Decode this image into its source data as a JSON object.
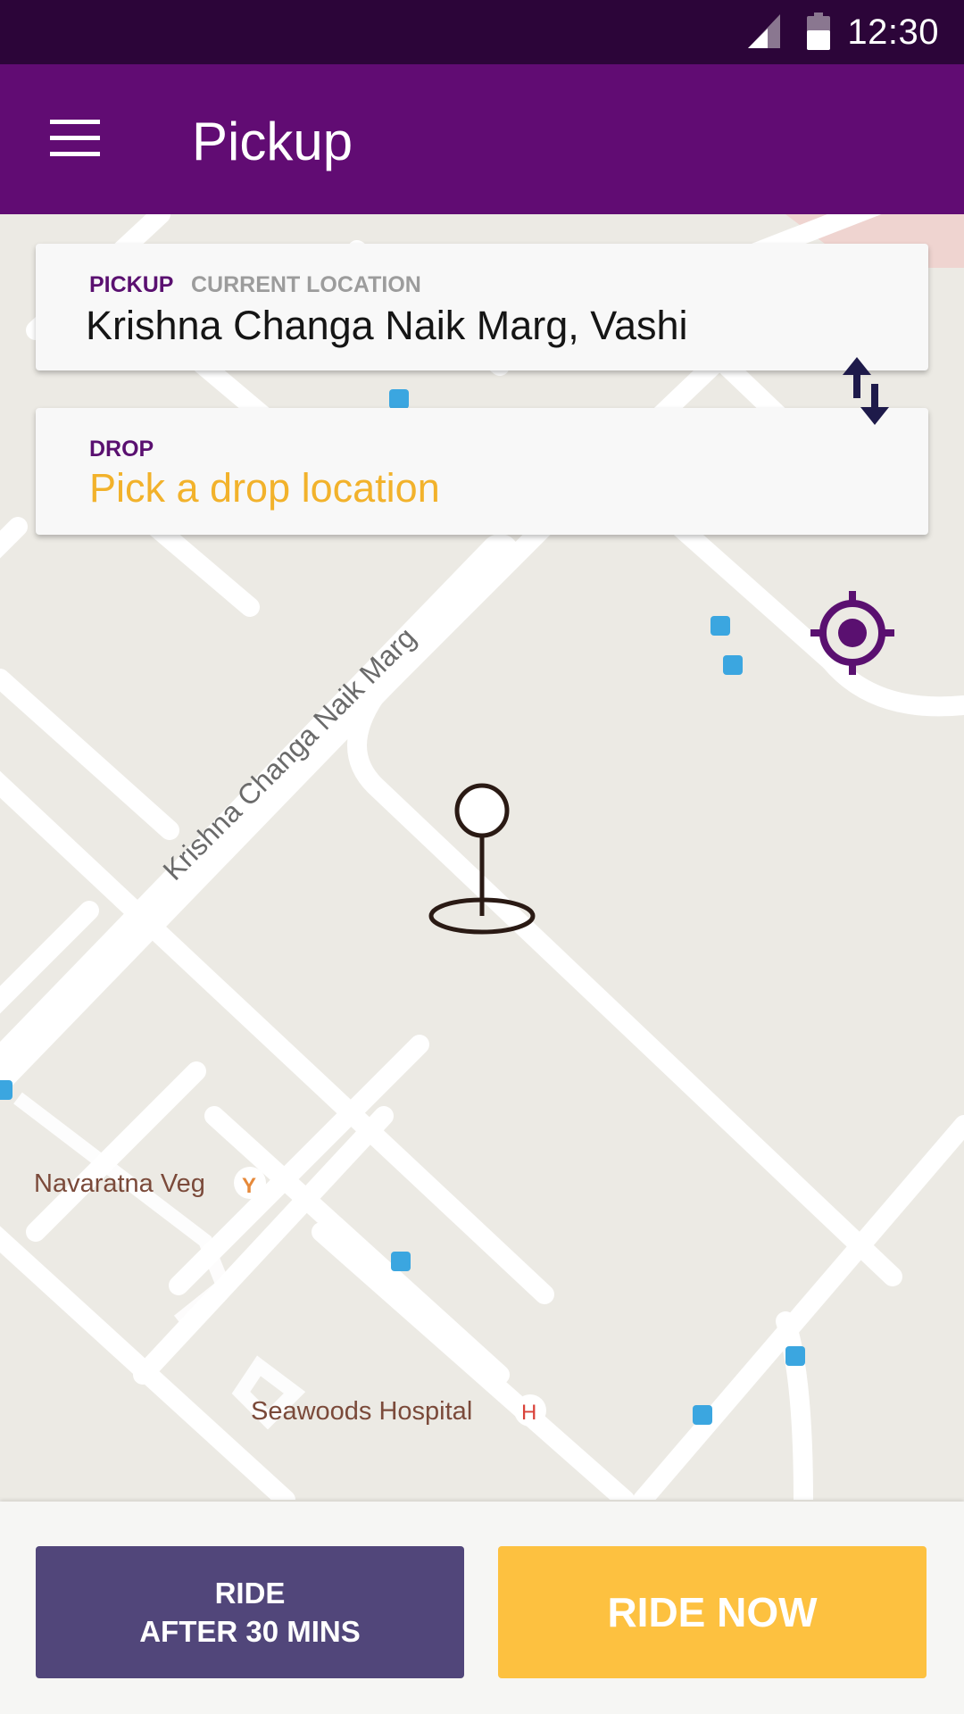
{
  "status_bar": {
    "time": "12:30"
  },
  "app_bar": {
    "title": "Pickup",
    "menu_icon": "hamburger-menu-icon"
  },
  "pickup_card": {
    "label": "PICKUP",
    "sublabel": "CURRENT LOCATION",
    "address": "Krishna Changa Naik Marg, Vashi"
  },
  "drop_card": {
    "label": "DROP",
    "placeholder": "Pick a drop location"
  },
  "map": {
    "road_label": "Krishna Changa Naik Marg",
    "places": {
      "restaurant": "Navaratna Veg",
      "hospital": "Seawoods Hospital"
    }
  },
  "buttons": {
    "later_line1": "RIDE",
    "later_line2": "AFTER 30 MINS",
    "now": "RIDE NOW"
  },
  "colors": {
    "status_bar": "#2C0539",
    "app_bar": "#610C73",
    "accent_yellow": "#FDC140",
    "secondary_button": "#51467A",
    "placeholder_text": "#F2B22B"
  },
  "icons": [
    "signal-icon",
    "battery-icon",
    "hamburger-menu-icon",
    "swap-icon",
    "my-location-icon",
    "map-pin-icon",
    "bus-stop-icon",
    "restaurant-icon",
    "hospital-icon"
  ]
}
